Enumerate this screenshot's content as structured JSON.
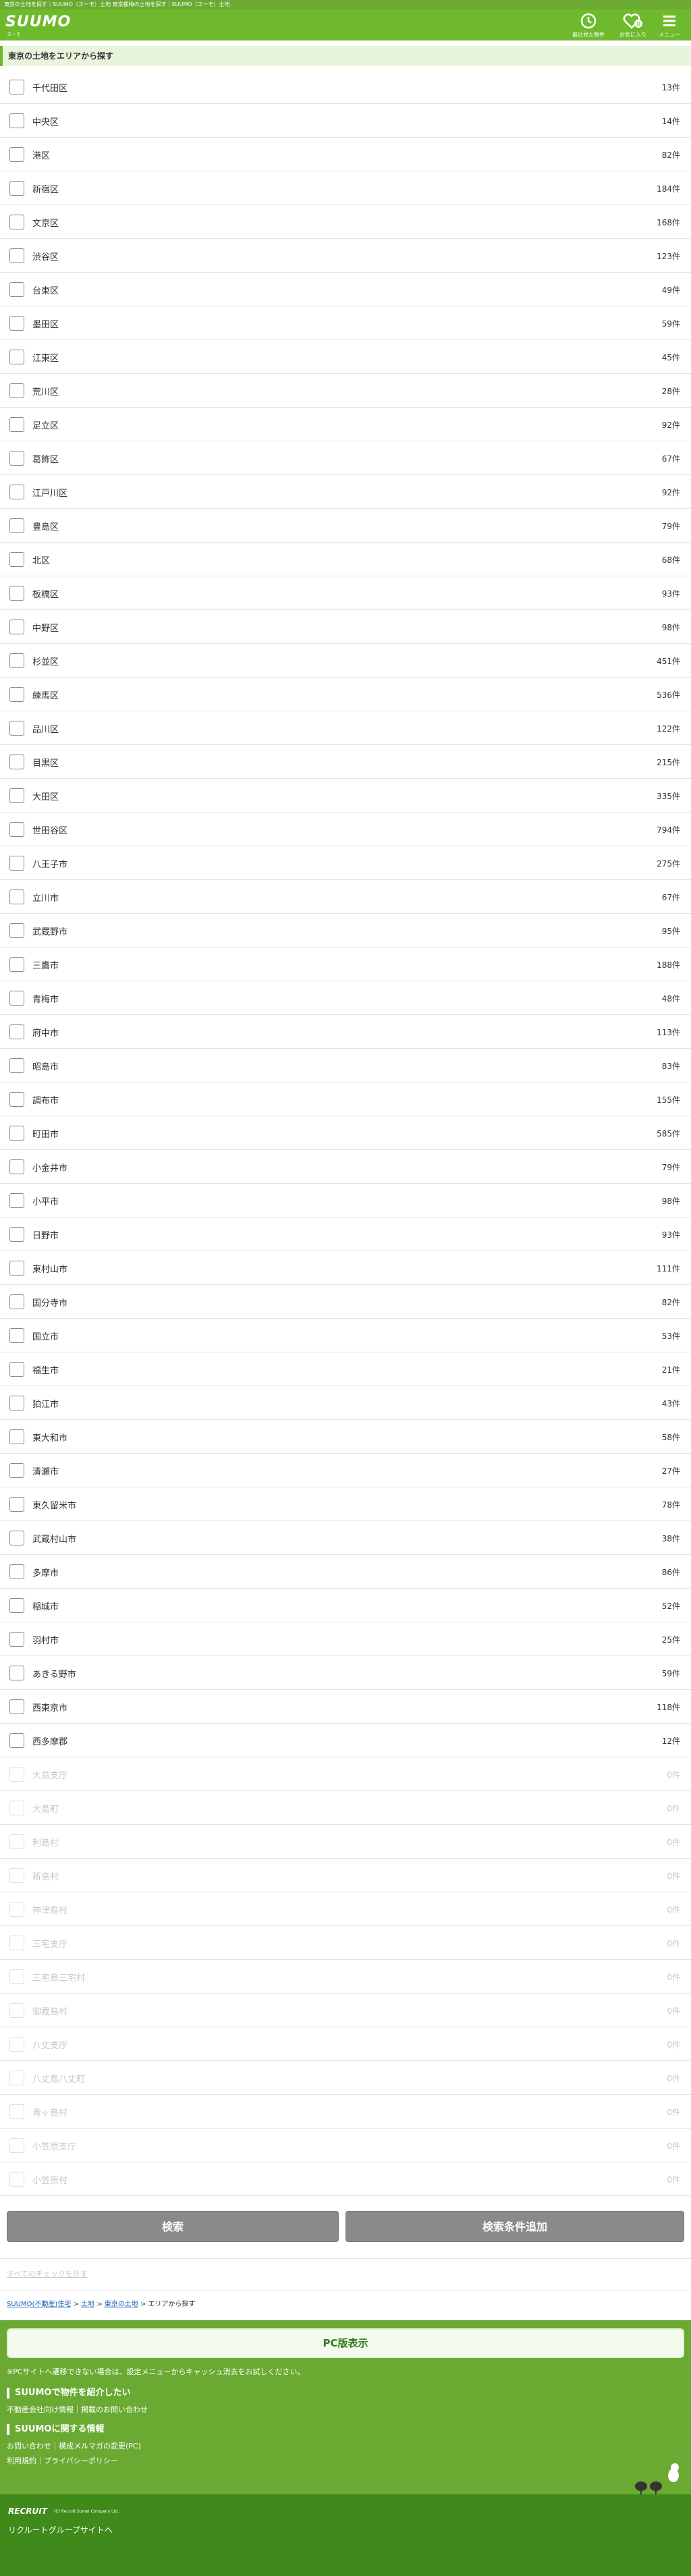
{
  "topline": "東京の土地を探す｜SUUMO（スーモ）土地 東京都梅の土地を探す｜SUUMO（スーモ）土地",
  "header": {
    "logo": "SUUMO",
    "logo_sub": "スーモ",
    "history_label": "最近見た物件",
    "favorite_label": "お気に入り",
    "favorite_count": "0",
    "menu_label": "メニュー"
  },
  "section_title": "東京の土地をエリアから探す",
  "areas": [
    {
      "name": "千代田区",
      "count": "13件"
    },
    {
      "name": "中央区",
      "count": "14件"
    },
    {
      "name": "港区",
      "count": "82件"
    },
    {
      "name": "新宿区",
      "count": "184件"
    },
    {
      "name": "文京区",
      "count": "168件"
    },
    {
      "name": "渋谷区",
      "count": "123件"
    },
    {
      "name": "台東区",
      "count": "49件"
    },
    {
      "name": "墨田区",
      "count": "59件"
    },
    {
      "name": "江東区",
      "count": "45件"
    },
    {
      "name": "荒川区",
      "count": "28件"
    },
    {
      "name": "足立区",
      "count": "92件"
    },
    {
      "name": "葛飾区",
      "count": "67件"
    },
    {
      "name": "江戸川区",
      "count": "92件"
    },
    {
      "name": "豊島区",
      "count": "79件"
    },
    {
      "name": "北区",
      "count": "68件"
    },
    {
      "name": "板橋区",
      "count": "93件"
    },
    {
      "name": "中野区",
      "count": "98件"
    },
    {
      "name": "杉並区",
      "count": "451件"
    },
    {
      "name": "練馬区",
      "count": "536件"
    },
    {
      "name": "品川区",
      "count": "122件"
    },
    {
      "name": "目黒区",
      "count": "215件"
    },
    {
      "name": "大田区",
      "count": "335件"
    },
    {
      "name": "世田谷区",
      "count": "794件"
    },
    {
      "name": "八王子市",
      "count": "275件"
    },
    {
      "name": "立川市",
      "count": "67件"
    },
    {
      "name": "武蔵野市",
      "count": "95件"
    },
    {
      "name": "三鷹市",
      "count": "188件"
    },
    {
      "name": "青梅市",
      "count": "48件"
    },
    {
      "name": "府中市",
      "count": "113件"
    },
    {
      "name": "昭島市",
      "count": "83件"
    },
    {
      "name": "調布市",
      "count": "155件"
    },
    {
      "name": "町田市",
      "count": "585件"
    },
    {
      "name": "小金井市",
      "count": "79件"
    },
    {
      "name": "小平市",
      "count": "98件"
    },
    {
      "name": "日野市",
      "count": "93件"
    },
    {
      "name": "東村山市",
      "count": "111件"
    },
    {
      "name": "国分寺市",
      "count": "82件"
    },
    {
      "name": "国立市",
      "count": "53件"
    },
    {
      "name": "福生市",
      "count": "21件"
    },
    {
      "name": "狛江市",
      "count": "43件"
    },
    {
      "name": "東大和市",
      "count": "58件"
    },
    {
      "name": "清瀬市",
      "count": "27件"
    },
    {
      "name": "東久留米市",
      "count": "78件"
    },
    {
      "name": "武蔵村山市",
      "count": "38件"
    },
    {
      "name": "多摩市",
      "count": "86件"
    },
    {
      "name": "稲城市",
      "count": "52件"
    },
    {
      "name": "羽村市",
      "count": "25件"
    },
    {
      "name": "あきる野市",
      "count": "59件"
    },
    {
      "name": "西東京市",
      "count": "118件"
    },
    {
      "name": "西多摩郡",
      "count": "12件"
    },
    {
      "name": "大島支庁",
      "count": "0件",
      "disabled": true
    },
    {
      "name": "大島町",
      "count": "0件",
      "disabled": true
    },
    {
      "name": "利島村",
      "count": "0件",
      "disabled": true
    },
    {
      "name": "新島村",
      "count": "0件",
      "disabled": true
    },
    {
      "name": "神津島村",
      "count": "0件",
      "disabled": true
    },
    {
      "name": "三宅支庁",
      "count": "0件",
      "disabled": true
    },
    {
      "name": "三宅島三宅村",
      "count": "0件",
      "disabled": true
    },
    {
      "name": "御蔵島村",
      "count": "0件",
      "disabled": true
    },
    {
      "name": "八丈支庁",
      "count": "0件",
      "disabled": true
    },
    {
      "name": "八丈島八丈町",
      "count": "0件",
      "disabled": true
    },
    {
      "name": "青ヶ島村",
      "count": "0件",
      "disabled": true
    },
    {
      "name": "小笠原支庁",
      "count": "0件",
      "disabled": true
    },
    {
      "name": "小笠原村",
      "count": "0件",
      "disabled": true
    }
  ],
  "buttons": {
    "search": "検索",
    "add_condition": "検索条件追加"
  },
  "clear_link": "すべてのチェックを外す",
  "breadcrumb": {
    "home": "SUUMO(不動産)住宅",
    "land": "土地",
    "tokyo": "東京の土地",
    "current": "エリアから探す"
  },
  "footer": {
    "pc_button": "PC版表示",
    "note": "※PCサイトへ遷移できない場合は、設定メニューからキャッシュ消去をお試しください。",
    "sec1_title": "SUUMOで物件を紹介したい",
    "sec1_links": "不動産会社向け情報｜掲載のお問い合わせ",
    "sec2_title": "SUUMOに関する情報",
    "sec2_links1": "お問い合わせ｜構成メルマガの変更(PC)",
    "sec2_links2": "利用規約｜プライバシーポリシー"
  },
  "bottom": {
    "brand": "RECRUIT",
    "copyright": "(C) Recruit Sumai Company Ltd.",
    "group_link": "リクルートグループサイトへ"
  },
  "colors": {
    "brand": "#6fba2c",
    "footer": "#6aaa33",
    "bottom": "#3f8a1b"
  }
}
